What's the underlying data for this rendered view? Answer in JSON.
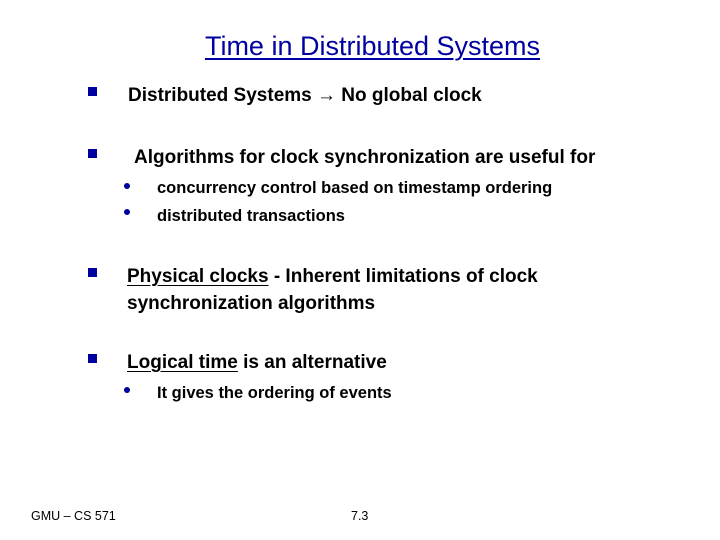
{
  "slide": {
    "title": "Time in Distributed Systems",
    "accent_color": "#0000a0",
    "bullets": [
      {
        "prefix": "Distributed Systems",
        "arrow": "→",
        "suffix": "No global clock"
      },
      {
        "text": "Algorithms for clock synchronization are useful for",
        "sub_bullets": [
          "concurrency control based on timestamp ordering",
          "distributed transactions"
        ]
      },
      {
        "underlined": "Physical clocks",
        "rest_line1": " - Inherent limitations of clock",
        "line2": "synchronization algorithms"
      },
      {
        "underlined": "Logical time",
        "rest": " is an alternative",
        "sub_bullets": [
          "It gives the ordering of events"
        ]
      }
    ]
  },
  "footer": {
    "left": "GMU – CS 571",
    "page": "7.3"
  }
}
